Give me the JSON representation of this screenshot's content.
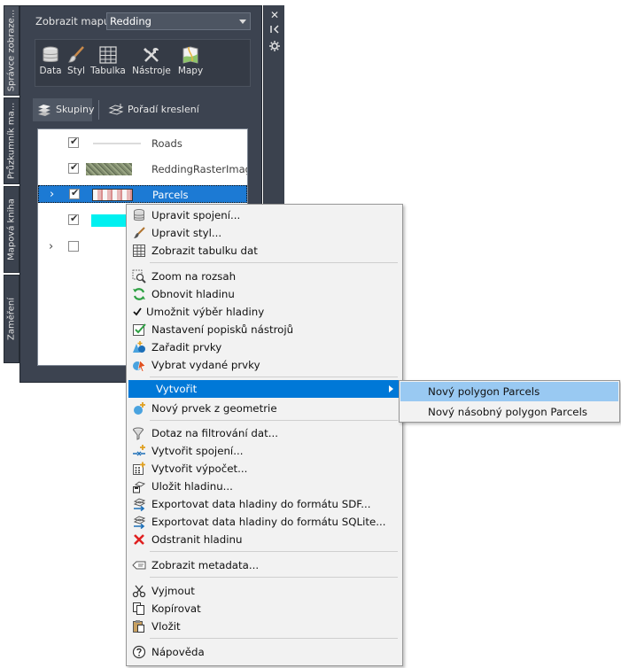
{
  "palette": {
    "map_label": "Zobrazit mapu:",
    "map_selected": "Redding",
    "vertical_tabs": [
      "Správce zobraze...",
      "Průzkumník ma...",
      "Mapová kniha",
      "Zaměření"
    ],
    "ribbon": [
      {
        "label": "Data",
        "icon": "database-icon"
      },
      {
        "label": "Styl",
        "icon": "brush-icon"
      },
      {
        "label": "Tabulka",
        "icon": "table-grid-icon"
      },
      {
        "label": "Nástroje",
        "icon": "tools-icon"
      },
      {
        "label": "Mapy",
        "icon": "map-icon"
      }
    ],
    "tabs": [
      {
        "label": "Skupiny",
        "icon": "groups-icon"
      },
      {
        "label": "Pořadí kreslení",
        "icon": "draw-order-icon"
      }
    ],
    "layers": [
      {
        "name": "Roads",
        "checked": true,
        "expandable": false,
        "selected": false
      },
      {
        "name": "ReddingRasterImage",
        "checked": true,
        "expandable": false,
        "selected": false
      },
      {
        "name": "Parcels",
        "checked": true,
        "expandable": true,
        "selected": true
      },
      {
        "name": "",
        "checked": true,
        "expandable": false,
        "selected": false
      },
      {
        "name": "",
        "checked": false,
        "expandable": true,
        "selected": false
      }
    ],
    "controls": [
      "close-icon",
      "auto-hide-icon",
      "properties-icon"
    ]
  },
  "context_menu": {
    "items": [
      {
        "label": "Upravit spojení...",
        "icon": "database-icon"
      },
      {
        "label": "Upravit styl...",
        "icon": "brush-icon"
      },
      {
        "label": "Zobrazit tabulku dat",
        "icon": "table-grid-icon"
      },
      {
        "label": "Zoom na rozsah",
        "icon": "zoom-extent-icon"
      },
      {
        "label": "Obnovit hladinu",
        "icon": "refresh-icon"
      },
      {
        "label": "Umožnit výběr hladiny",
        "icon": "checkmark-icon"
      },
      {
        "label": "Nastavení popisků nástrojů",
        "icon": "tooltip-settings-icon"
      },
      {
        "label": "Zařadit prvky",
        "icon": "insert-features-icon"
      },
      {
        "label": "Vybrat vydané prvky",
        "icon": "select-features-icon"
      },
      {
        "label": "Vytvořit",
        "icon": ""
      },
      {
        "label": "Nový prvek z geometrie",
        "icon": "new-feature-icon"
      },
      {
        "label": "Dotaz na filtrování dat...",
        "icon": "filter-query-icon"
      },
      {
        "label": "Vytvořit spojení...",
        "icon": "create-join-icon"
      },
      {
        "label": "Vytvořit výpočet...",
        "icon": "calculator-icon"
      },
      {
        "label": "Uložit hladinu...",
        "icon": "save-layer-icon"
      },
      {
        "label": "Exportovat data hladiny do formátu SDF...",
        "icon": "export-sdf-icon"
      },
      {
        "label": "Exportovat data hladiny do formátu SQLite...",
        "icon": "export-sqlite-icon"
      },
      {
        "label": "Odstranit hladinu",
        "icon": "delete-icon"
      },
      {
        "label": "Zobrazit metadata...",
        "icon": "metadata-icon"
      },
      {
        "label": "Vyjmout",
        "icon": "scissors-icon"
      },
      {
        "label": "Kopírovat",
        "icon": "copy-icon"
      },
      {
        "label": "Vložit",
        "icon": "paste-icon"
      },
      {
        "label": "Nápověda",
        "icon": "help-icon"
      }
    ]
  },
  "submenu": {
    "items": [
      {
        "label": "Nový polygon Parcels"
      },
      {
        "label": "Nový násobný polygon Parcels"
      }
    ]
  },
  "colors": {
    "panel_bg": "#3c4350",
    "selection": "#1c7ad4",
    "menu_highlight": "#0078d7",
    "submenu_highlight": "#99c9f2",
    "delete_red": "#e02020",
    "refresh_green": "#2ea043"
  }
}
